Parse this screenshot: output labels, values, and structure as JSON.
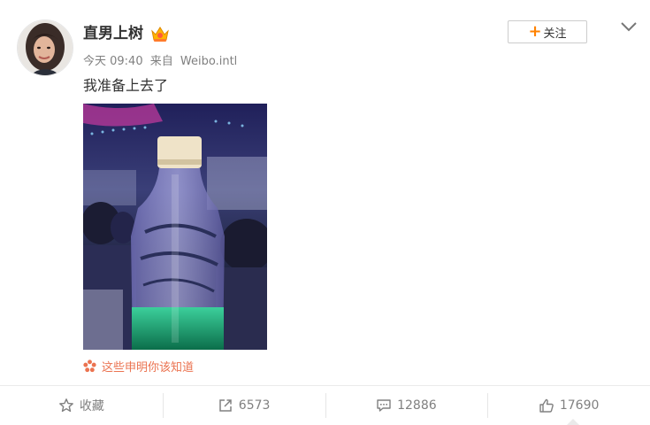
{
  "post": {
    "username": "直男上树",
    "time": "今天 09:40",
    "source_prefix": "来自",
    "source": "Weibo.intl",
    "text": "我准备上去了"
  },
  "header": {
    "follow_label": "关注"
  },
  "notice": {
    "label": "这些申明你该知道"
  },
  "actions": {
    "favorite_label": "收藏",
    "repost_count": "6573",
    "comment_count": "12886",
    "like_count": "17690"
  },
  "colors": {
    "accent": "#ff8200",
    "notice": "#eb7350",
    "muted": "#808080"
  }
}
